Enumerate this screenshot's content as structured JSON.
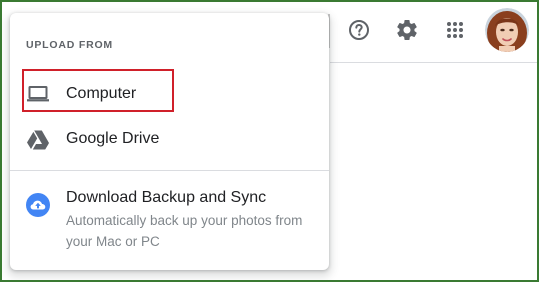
{
  "upload_menu": {
    "heading": "UPLOAD FROM",
    "items": [
      {
        "label": "Computer",
        "icon": "laptop-icon"
      },
      {
        "label": "Google Drive",
        "icon": "google-drive-icon"
      }
    ],
    "backup_item": {
      "title": "Download Backup and Sync",
      "description": "Automatically back up your photos from your Mac or PC",
      "icon": "cloud-upload-icon"
    }
  },
  "toolbar": {
    "icons": [
      "help-icon",
      "settings-gear-icon",
      "apps-grid-icon",
      "account-avatar"
    ]
  },
  "colors": {
    "frame_border": "#3a7a32",
    "highlight_box": "#d0202a",
    "icon_gray": "#5f6368",
    "backup_blue": "#4285f4",
    "muted_text": "#80868b"
  }
}
